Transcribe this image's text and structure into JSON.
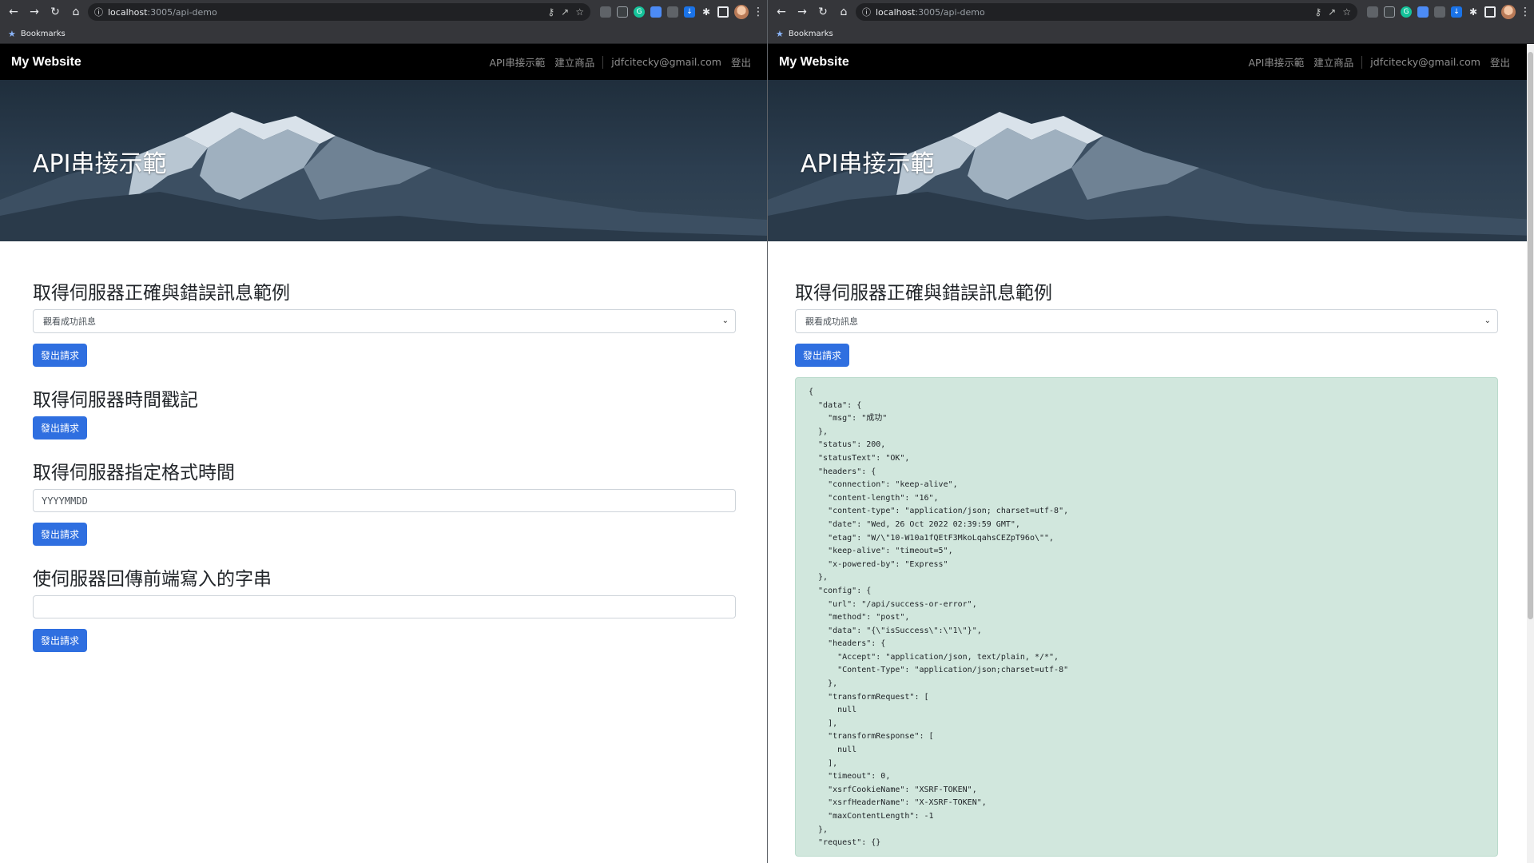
{
  "browser": {
    "url_host": "localhost",
    "url_path": ":3005/api-demo",
    "bookmarks_label": "Bookmarks"
  },
  "site": {
    "brand": "My Website",
    "nav": {
      "api_demo": "API串接示範",
      "create_product": "建立商品",
      "email": "jdfcitecky@gmail.com",
      "logout": "登出"
    },
    "hero_title": "API串接示範"
  },
  "sections": {
    "success_error": {
      "title": "取得伺服器正確與錯誤訊息範例",
      "select_value": "觀看成功訊息",
      "button": "發出請求"
    },
    "timestamp": {
      "title": "取得伺服器時間戳記",
      "button": "發出請求"
    },
    "format_time": {
      "title": "取得伺服器指定格式時間",
      "input_value": "YYYYMMDD",
      "button": "發出請求"
    },
    "echo": {
      "title": "使伺服器回傳前端寫入的字串",
      "input_value": "",
      "button": "發出請求"
    }
  },
  "response_text": "{\n  \"data\": {\n    \"msg\": \"成功\"\n  },\n  \"status\": 200,\n  \"statusText\": \"OK\",\n  \"headers\": {\n    \"connection\": \"keep-alive\",\n    \"content-length\": \"16\",\n    \"content-type\": \"application/json; charset=utf-8\",\n    \"date\": \"Wed, 26 Oct 2022 02:39:59 GMT\",\n    \"etag\": \"W/\\\"10-W10a1fQEtF3MkoLqahsCEZpT96o\\\"\",\n    \"keep-alive\": \"timeout=5\",\n    \"x-powered-by\": \"Express\"\n  },\n  \"config\": {\n    \"url\": \"/api/success-or-error\",\n    \"method\": \"post\",\n    \"data\": \"{\\\"isSuccess\\\":\\\"1\\\"}\",\n    \"headers\": {\n      \"Accept\": \"application/json, text/plain, */*\",\n      \"Content-Type\": \"application/json;charset=utf-8\"\n    },\n    \"transformRequest\": [\n      null\n    ],\n    \"transformResponse\": [\n      null\n    ],\n    \"timeout\": 0,\n    \"xsrfCookieName\": \"XSRF-TOKEN\",\n    \"xsrfHeaderName\": \"X-XSRF-TOKEN\",\n    \"maxContentLength\": -1\n  },\n  \"request\": {}",
  "colors": {
    "primary_button": "#2f6fe0",
    "alert_success_bg": "#d1e7dd",
    "navbar_bg": "#000000"
  }
}
